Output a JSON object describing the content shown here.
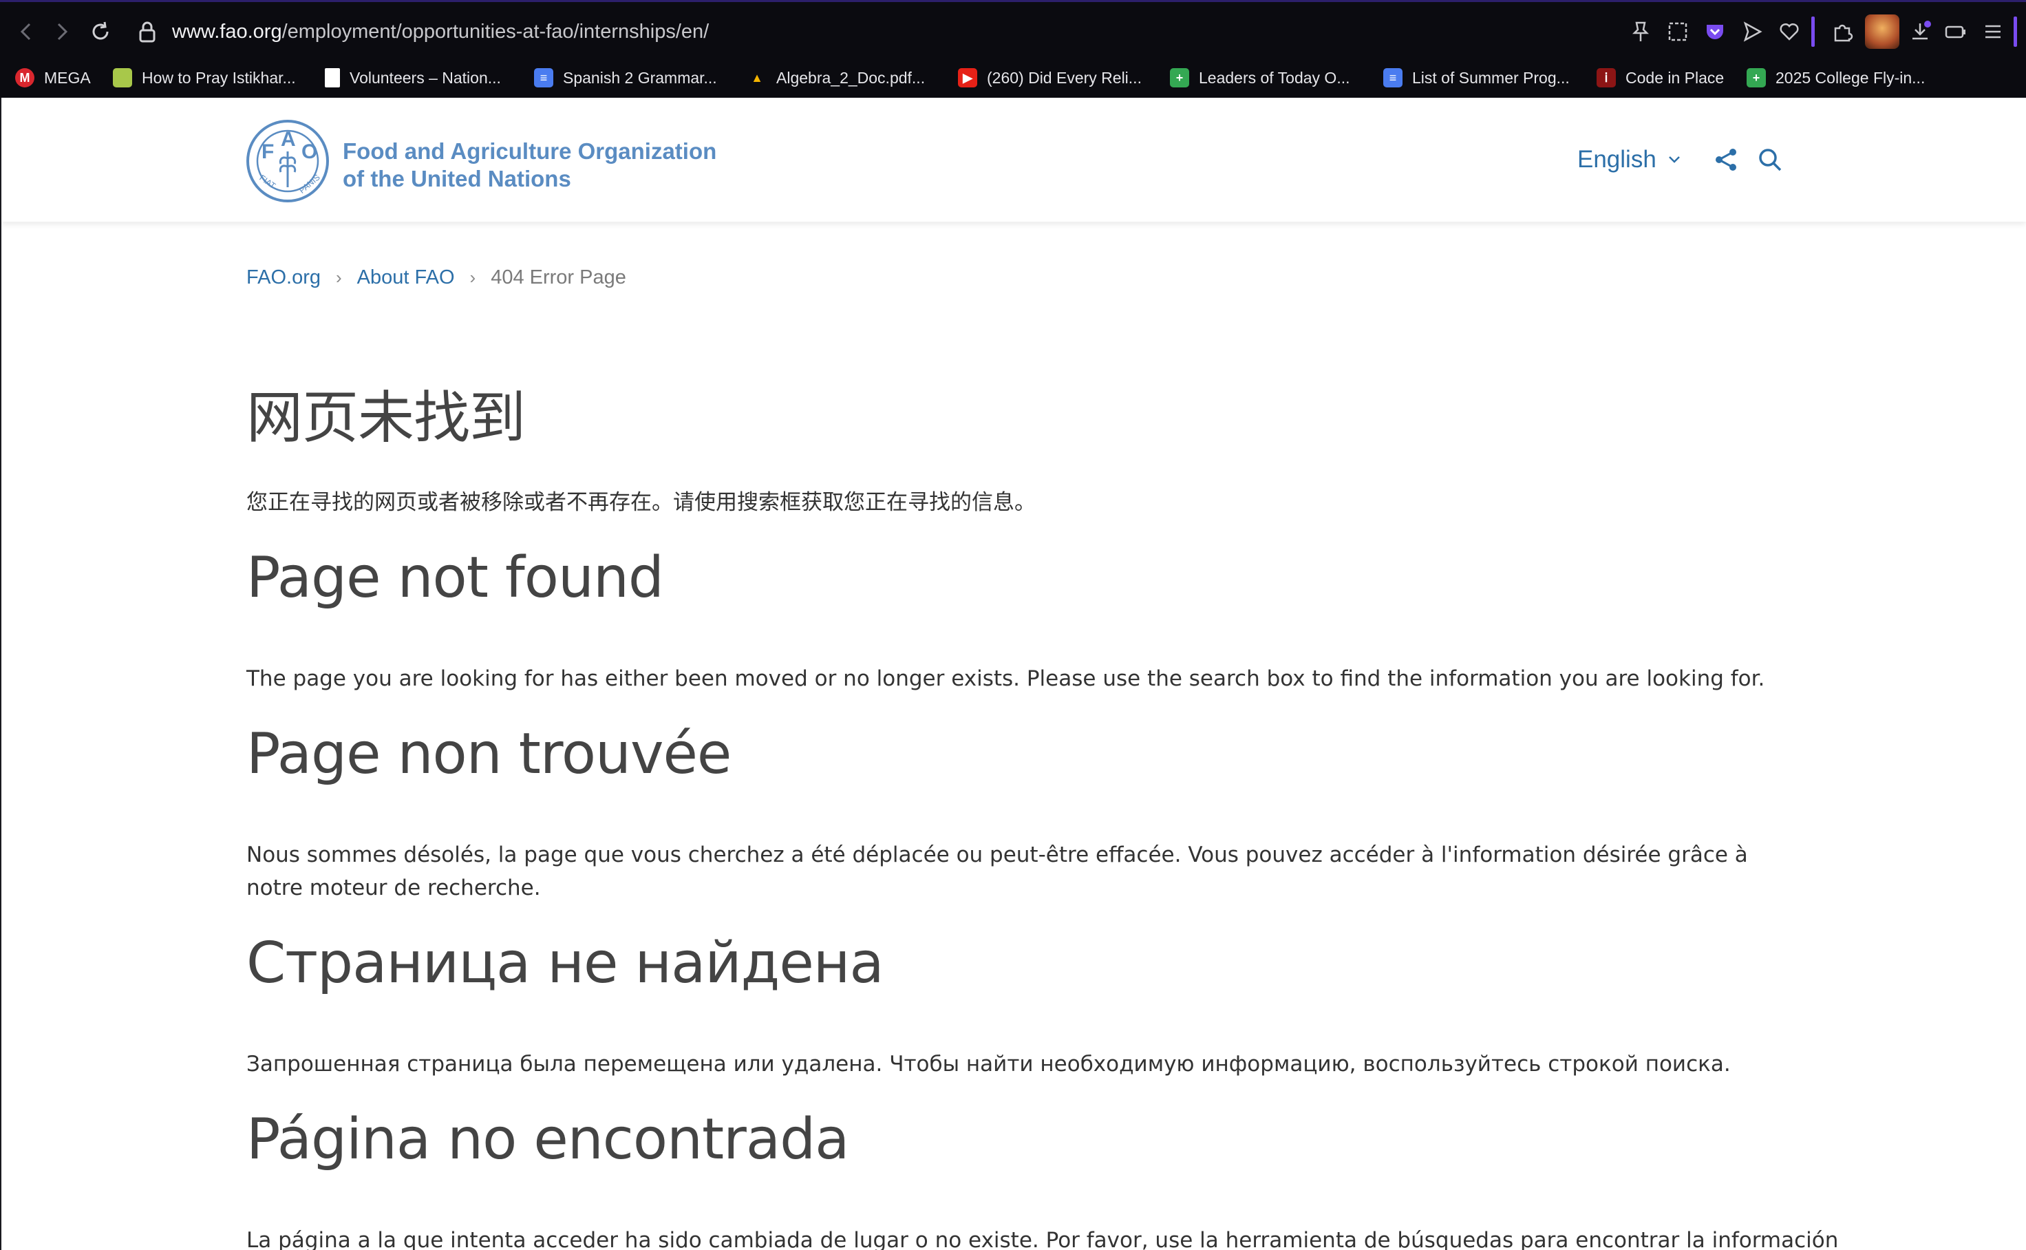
{
  "browser": {
    "url_host": "www.fao.org",
    "url_path": "/employment/opportunities-at-fao/internships/en/",
    "bookmarks": [
      {
        "label": "MEGA",
        "icon": "mega-icon",
        "color": "#d9272e",
        "glyph": "M"
      },
      {
        "label": "How to Pray Istikhar...",
        "icon": "page-icon",
        "color": "#a8c84a",
        "glyph": ""
      },
      {
        "label": "Volunteers – Nation...",
        "icon": "document-icon",
        "color": "#ffffff",
        "glyph": ""
      },
      {
        "label": "Spanish 2 Grammar...",
        "icon": "google-docs-icon",
        "color": "#4a7cf0",
        "glyph": "≡"
      },
      {
        "label": "Algebra_2_Doc.pdf...",
        "icon": "google-drive-icon",
        "color": "#f4b400",
        "glyph": "▲"
      },
      {
        "label": "(260) Did Every Reli...",
        "icon": "youtube-icon",
        "color": "#e62117",
        "glyph": "▶"
      },
      {
        "label": "Leaders of Today O...",
        "icon": "google-sheets-icon",
        "color": "#34a853",
        "glyph": "+"
      },
      {
        "label": "List of Summer Prog...",
        "icon": "google-docs-icon",
        "color": "#4a7cf0",
        "glyph": "≡"
      },
      {
        "label": "Code in Place",
        "icon": "stanford-icon",
        "color": "#8c1515",
        "glyph": "ⅰ"
      },
      {
        "label": "2025 College Fly-in...",
        "icon": "google-sheets-icon",
        "color": "#34a853",
        "glyph": "+"
      }
    ]
  },
  "header": {
    "org_line1": "Food and Agriculture Organization",
    "org_line2": "of the United Nations",
    "language": "English"
  },
  "breadcrumb": {
    "home": "FAO.org",
    "parent": "About FAO",
    "current": "404 Error Page"
  },
  "messages": [
    {
      "heading": "网页未找到",
      "text": "您正在寻找的网页或者被移除或者不再存在。请使用搜索框获取您正在寻找的信息。"
    },
    {
      "heading": "Page not found",
      "text": "The page you are looking for has either been moved or no longer exists. Please use the search box to find the information you are looking for."
    },
    {
      "heading": "Page non trouvée",
      "text": "Nous sommes désolés, la page que vous cherchez a été déplacée ou peut-être effacée. Vous pouvez accéder à l'information désirée grâce à notre moteur de recherche."
    },
    {
      "heading": "Страница не найдена",
      "text": "Запрошенная страница была перемещена или удалена. Чтобы найти необходимую информацию, воспользуйтесь строкой поиска."
    },
    {
      "heading": "Página no encontrada",
      "text": "La página a la que intenta acceder ha sido cambiada de lugar o no existe. Por favor, use la herramienta de búsquedas para encontrar la información"
    }
  ],
  "colors": {
    "link": "#2c6fa8",
    "logo": "#5a8cc2"
  }
}
